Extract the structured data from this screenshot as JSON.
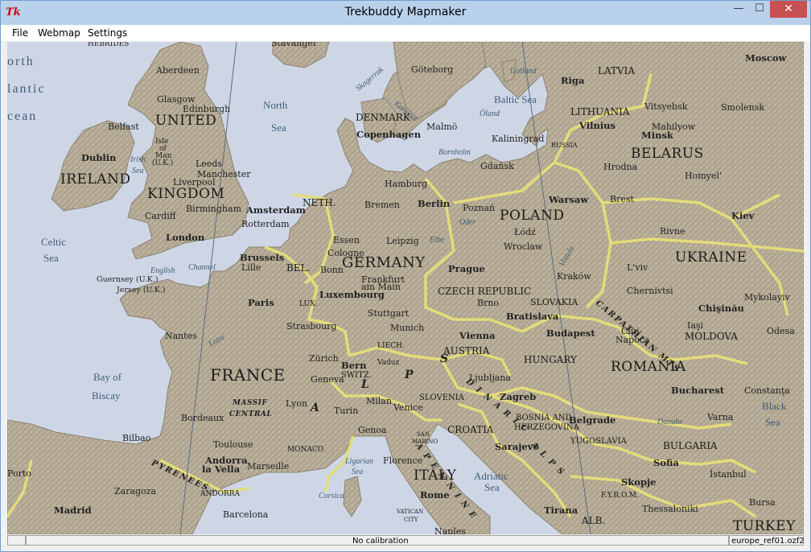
{
  "window": {
    "title": "Trekbuddy Mapmaker",
    "app_icon": "Tk",
    "controls": {
      "minimize": "—",
      "maximize": "☐",
      "close": "✕"
    }
  },
  "menu": {
    "items": [
      "File",
      "Webmap",
      "Settings"
    ]
  },
  "map": {
    "seas": {
      "north_atlantic_1": "orth",
      "north_atlantic_2": "lantic",
      "north_atlantic_3": "cean",
      "north_sea_1": "North",
      "north_sea_2": "Sea",
      "irish_sea_1": "Irish",
      "irish_sea_2": "Sea",
      "celtic_sea_1": "Celtic",
      "celtic_sea_2": "Sea",
      "english_channel_1": "English",
      "english_channel_2": "Channel",
      "baltic_sea": "Baltic Sea",
      "skagerrak": "Skagerrak",
      "kattegat": "Kattegat",
      "bay_of_biscay_1": "Bay of",
      "bay_of_biscay_2": "Biscay",
      "ligurian_sea_1": "Ligurian",
      "ligurian_sea_2": "Sea",
      "corsica": "Corsica",
      "adriatic_sea_1": "Adriatic",
      "adriatic_sea_2": "Sea",
      "black_sea_1": "Black",
      "black_sea_2": "Sea",
      "danube": "Danube",
      "oder": "Oder",
      "elbe": "Elbe",
      "vistula": "Vistula",
      "loire": "Loire"
    },
    "countries": {
      "united": "UNITED",
      "kingdom": "KINGDOM",
      "ireland": "IRELAND",
      "france": "FRANCE",
      "germany": "GERMANY",
      "poland": "POLAND",
      "ukraine": "UKRAINE",
      "belarus": "BELARUS",
      "lithuania": "LITHUANIA",
      "latvia": "LATVIA",
      "denmark": "DENMARK",
      "neth": "NETH.",
      "bel": "BEL.",
      "lux": "LUX.",
      "czech": "CZECH REPUBLIC",
      "slovakia": "SLOVAKIA",
      "austria": "AUSTRIA",
      "hungary": "HUNGARY",
      "romania": "ROMANIA",
      "moldova": "MOLDOVA",
      "switz": "SWITZ.",
      "liech": "LIECH.",
      "slovenia": "SLOVENIA",
      "croatia": "CROATIA",
      "bosnia_1": "BOSNIA AND",
      "bosnia_2": "HERZEGOVINA",
      "yugoslavia": "YUGOSLAVIA",
      "bulgaria": "BULGARIA",
      "italy": "ITALY",
      "fyrom": "F.Y.R.O.M.",
      "alb": "ALB.",
      "turkey": "TURKEY",
      "monaco": "MONACO",
      "andorra": "ANDORRA",
      "san_marino_1": "SAN",
      "san_marino_2": "MARINO",
      "vatican_1": "VATICAN",
      "vatican_2": "CITY",
      "russia": "RUSSIA",
      "isle_of_man_1": "Isle",
      "isle_of_man_2": "of",
      "isle_of_man_3": "Man",
      "isle_of_man_4": "(U.K.)",
      "guernsey": "Guernsey (U.K.)",
      "jersey": "Jersey (U.K.)"
    },
    "mountains": {
      "pyrenees": "PYRENEES",
      "massif_1": "MASSIF",
      "massif_2": "CENTRAL",
      "alps_a": "A",
      "alps_l": "L",
      "alps_p": "P",
      "alps_s": "S",
      "carpathian": "CARPATHIAN MTS",
      "apennine": "A P E N N I N E",
      "dinaric": "D I N A R I C",
      "dinaric_alps": "A L P S"
    },
    "cities": {
      "hebrides": "HEBRIDES",
      "stavanger": "Stavanger",
      "goteborg": "Göteborg",
      "gotland": "Gotland",
      "oland": "Öland",
      "bornholm": "Bornholm",
      "moscow": "Moscow",
      "riga": "Riga",
      "vilnius": "Vilnius",
      "minsk": "Minsk",
      "vitsyebsk": "Vitsyebsk",
      "smolensk": "Smolensk",
      "mahilyow": "Mahilyow",
      "homyel": "Homyel'",
      "hrodna": "Hrodna",
      "brest": "Brest",
      "kiev": "Kiev",
      "rivne": "Rivne",
      "lviv": "L'viv",
      "chernivtsi": "Chernivtsi",
      "kaliningrad": "Kaliningrad",
      "aberdeen": "Aberdeen",
      "glasgow": "Glasgow",
      "edinburgh": "Edinburgh",
      "belfast": "Belfast",
      "dublin": "Dublin",
      "leeds": "Leeds",
      "manchester": "Manchester",
      "liverpool": "Liverpool",
      "birmingham": "Birmingham",
      "cardiff": "Cardiff",
      "london": "London",
      "copenhagen": "Copenhagen",
      "malmo": "Malmö",
      "hamburg": "Hamburg",
      "bremen": "Bremen",
      "berlin": "Berlin",
      "gdansk": "Gdańsk",
      "poznan": "Poznań",
      "warsaw": "Warsaw",
      "lodz": "Łódź",
      "wroclaw": "Wroclaw",
      "krakow": "Kraków",
      "amsterdam": "Amsterdam",
      "rotterdam": "Rotterdam",
      "essen": "Essen",
      "cologne": "Cologne",
      "leipzig": "Leipzig",
      "brussels": "Brussels",
      "lille": "Lille",
      "bonn": "Bonn",
      "frankfurt_1": "Frankfurt",
      "frankfurt_2": "am Main",
      "luxembourg": "Luxembourg",
      "prague": "Prague",
      "brno": "Brno",
      "paris": "Paris",
      "strasbourg": "Strasbourg",
      "stuttgart": "Stuttgart",
      "munich": "Munich",
      "vienna": "Vienna",
      "bratislava": "Bratislava",
      "budapest": "Budapest",
      "cluj_1": "Cluj-",
      "cluj_2": "Napoca",
      "iasi": "Iaşi",
      "chisinau": "Chişinău",
      "mykolayiv": "Mykolayiv",
      "odesa": "Odesa",
      "nantes": "Nantes",
      "zurich": "Zürich",
      "bern": "Bern",
      "vaduz": "Vaduz",
      "geneva": "Geneva",
      "lyon": "Lyon",
      "bordeaux": "Bordeaux",
      "toulouse": "Toulouse",
      "marseille": "Marseille",
      "andorra_la_vella_1": "Andorra",
      "andorra_la_vella_2": "la Vella",
      "bilbao": "Bilbao",
      "zaragoza": "Zaragoza",
      "madrid": "Madrid",
      "barcelona": "Barcelona",
      "porto": "Porto",
      "turin": "Turin",
      "milan": "Milan",
      "genoa": "Genoa",
      "venice": "Venice",
      "ljubljana": "Ljubljana",
      "zagreb": "Zagreb",
      "florence": "Florence",
      "rome": "Rome",
      "naples": "Naples",
      "sarajevo": "Sarajevo",
      "belgrade": "Belgrade",
      "bucharest": "Bucharest",
      "constanta": "Constanţa",
      "varna": "Varna",
      "sofia": "Sofia",
      "skopje": "Skopje",
      "tirana": "Tirana",
      "thessaloniki": "Thessaloniki",
      "istanbul": "İstanbul",
      "bursa": "Bursa"
    }
  },
  "status": {
    "left": "",
    "center": "No calibration",
    "right": "europe_ref01.ozf2"
  }
}
